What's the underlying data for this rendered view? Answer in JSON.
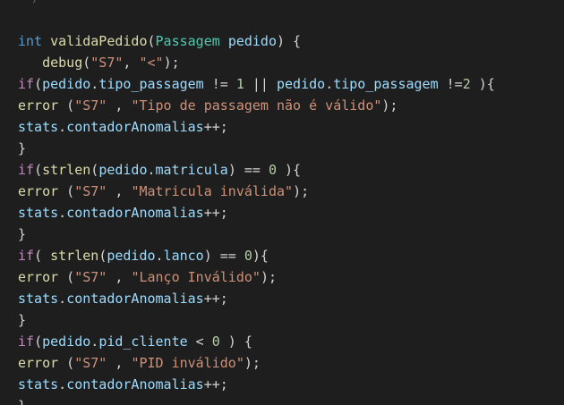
{
  "editor": {
    "top_fragment": "/",
    "lines": [
      {
        "tokens": [
          {
            "t": "int",
            "c": "kw"
          },
          {
            "t": " ",
            "c": "p"
          },
          {
            "t": "validaPedido",
            "c": "fn"
          },
          {
            "t": "(",
            "c": "p"
          },
          {
            "t": "Passagem",
            "c": "ty"
          },
          {
            "t": " ",
            "c": "p"
          },
          {
            "t": "pedido",
            "c": "var"
          },
          {
            "t": ") {",
            "c": "p"
          }
        ]
      },
      {
        "tokens": [
          {
            "t": "   ",
            "c": "p"
          },
          {
            "t": "debug",
            "c": "fn"
          },
          {
            "t": "(",
            "c": "p"
          },
          {
            "t": "\"S7\"",
            "c": "str"
          },
          {
            "t": ", ",
            "c": "p"
          },
          {
            "t": "\"<\"",
            "c": "str"
          },
          {
            "t": ");",
            "c": "p"
          }
        ]
      },
      {
        "tokens": [
          {
            "t": "if",
            "c": "ctl"
          },
          {
            "t": "(",
            "c": "p"
          },
          {
            "t": "pedido",
            "c": "var"
          },
          {
            "t": ".",
            "c": "p"
          },
          {
            "t": "tipo_passagem",
            "c": "var"
          },
          {
            "t": " != ",
            "c": "p"
          },
          {
            "t": "1",
            "c": "num"
          },
          {
            "t": " || ",
            "c": "p"
          },
          {
            "t": "pedido",
            "c": "var"
          },
          {
            "t": ".",
            "c": "p"
          },
          {
            "t": "tipo_passagem",
            "c": "var"
          },
          {
            "t": " !=",
            "c": "p"
          },
          {
            "t": "2",
            "c": "num"
          },
          {
            "t": " ){",
            "c": "p"
          }
        ]
      },
      {
        "tokens": [
          {
            "t": "error",
            "c": "fn"
          },
          {
            "t": " (",
            "c": "p"
          },
          {
            "t": "\"S7\"",
            "c": "str"
          },
          {
            "t": " , ",
            "c": "p"
          },
          {
            "t": "\"Tipo de passagem não é válido\"",
            "c": "str"
          },
          {
            "t": ");",
            "c": "p"
          }
        ]
      },
      {
        "tokens": [
          {
            "t": "stats",
            "c": "var"
          },
          {
            "t": ".",
            "c": "p"
          },
          {
            "t": "contadorAnomalias",
            "c": "var"
          },
          {
            "t": "++;",
            "c": "p"
          }
        ]
      },
      {
        "tokens": [
          {
            "t": "}",
            "c": "p"
          }
        ]
      },
      {
        "tokens": [
          {
            "t": "if",
            "c": "ctl"
          },
          {
            "t": "(",
            "c": "p"
          },
          {
            "t": "strlen",
            "c": "fn"
          },
          {
            "t": "(",
            "c": "p"
          },
          {
            "t": "pedido",
            "c": "var"
          },
          {
            "t": ".",
            "c": "p"
          },
          {
            "t": "matricula",
            "c": "var"
          },
          {
            "t": ") == ",
            "c": "p"
          },
          {
            "t": "0",
            "c": "num"
          },
          {
            "t": " ){",
            "c": "p"
          }
        ]
      },
      {
        "tokens": [
          {
            "t": "error",
            "c": "fn"
          },
          {
            "t": " (",
            "c": "p"
          },
          {
            "t": "\"S7\"",
            "c": "str"
          },
          {
            "t": " , ",
            "c": "p"
          },
          {
            "t": "\"Matricula inválida\"",
            "c": "str"
          },
          {
            "t": ");",
            "c": "p"
          }
        ]
      },
      {
        "tokens": [
          {
            "t": "stats",
            "c": "var"
          },
          {
            "t": ".",
            "c": "p"
          },
          {
            "t": "contadorAnomalias",
            "c": "var"
          },
          {
            "t": "++;",
            "c": "p"
          }
        ]
      },
      {
        "tokens": [
          {
            "t": "}",
            "c": "p"
          }
        ]
      },
      {
        "tokens": [
          {
            "t": "if",
            "c": "ctl"
          },
          {
            "t": "( ",
            "c": "p"
          },
          {
            "t": "strlen",
            "c": "fn"
          },
          {
            "t": "(",
            "c": "p"
          },
          {
            "t": "pedido",
            "c": "var"
          },
          {
            "t": ".",
            "c": "p"
          },
          {
            "t": "lanco",
            "c": "var"
          },
          {
            "t": ") == ",
            "c": "p"
          },
          {
            "t": "0",
            "c": "num"
          },
          {
            "t": "){",
            "c": "p"
          }
        ]
      },
      {
        "tokens": [
          {
            "t": "error",
            "c": "fn"
          },
          {
            "t": " (",
            "c": "p"
          },
          {
            "t": "\"S7\"",
            "c": "str"
          },
          {
            "t": " , ",
            "c": "p"
          },
          {
            "t": "\"Lanço Inválido\"",
            "c": "str"
          },
          {
            "t": ");",
            "c": "p"
          }
        ]
      },
      {
        "tokens": [
          {
            "t": "stats",
            "c": "var"
          },
          {
            "t": ".",
            "c": "p"
          },
          {
            "t": "contadorAnomalias",
            "c": "var"
          },
          {
            "t": "++;",
            "c": "p"
          }
        ]
      },
      {
        "tokens": [
          {
            "t": "}",
            "c": "p"
          }
        ]
      },
      {
        "tokens": [
          {
            "t": "if",
            "c": "ctl"
          },
          {
            "t": "(",
            "c": "p"
          },
          {
            "t": "pedido",
            "c": "var"
          },
          {
            "t": ".",
            "c": "p"
          },
          {
            "t": "pid_cliente",
            "c": "var"
          },
          {
            "t": " < ",
            "c": "p"
          },
          {
            "t": "0",
            "c": "num"
          },
          {
            "t": " ) {",
            "c": "p"
          }
        ]
      },
      {
        "tokens": [
          {
            "t": "error",
            "c": "fn"
          },
          {
            "t": " (",
            "c": "p"
          },
          {
            "t": "\"S7\"",
            "c": "str"
          },
          {
            "t": " , ",
            "c": "p"
          },
          {
            "t": "\"PID inválido\"",
            "c": "str"
          },
          {
            "t": ");",
            "c": "p"
          }
        ]
      },
      {
        "tokens": [
          {
            "t": "stats",
            "c": "var"
          },
          {
            "t": ".",
            "c": "p"
          },
          {
            "t": "contadorAnomalias",
            "c": "var"
          },
          {
            "t": "++;",
            "c": "p"
          }
        ]
      },
      {
        "tokens": [
          {
            "t": "}",
            "c": "p"
          }
        ]
      }
    ]
  },
  "colors": {
    "background": "#1e1e1e",
    "keyword": "#569cd6",
    "control": "#c586c0",
    "function": "#dcdcaa",
    "type": "#4ec9b0",
    "variable": "#9cdcfe",
    "string": "#ce9178",
    "number": "#b5cea8",
    "punctuation": "#d4d4d4"
  }
}
